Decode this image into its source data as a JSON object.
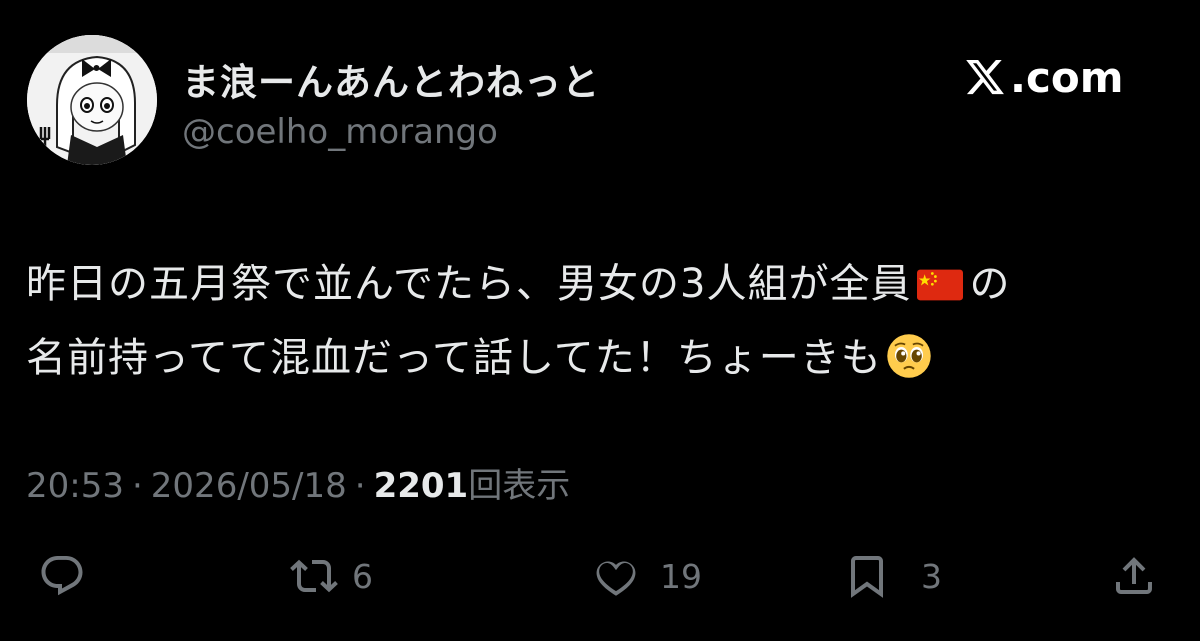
{
  "tweet": {
    "author": {
      "display_name": "ま浪ーんあんとわねっと",
      "handle": "@coelho_morango"
    },
    "brand": {
      "domain": ".com",
      "icon": "x-logo-icon"
    },
    "text": {
      "line1_before_flag": "昨日の五月祭で並んでたら、男女の3人組が全員",
      "line1_flag_emoji": "china-flag-emoji",
      "line1_after_flag": "の",
      "line2_before_emoji": "名前持ってて混血だって話してた！ちょーきも",
      "line2_emoji": "pleading-face-emoji"
    },
    "meta": {
      "time": "20:53",
      "separator": "·",
      "date": "2026/05/18",
      "views_count": "2201",
      "views_label": "回表示"
    },
    "actions": {
      "reply": {
        "icon": "reply-icon",
        "count": ""
      },
      "retweet": {
        "icon": "retweet-icon",
        "count": "6"
      },
      "like": {
        "icon": "heart-icon",
        "count": "19"
      },
      "bookmark": {
        "icon": "bookmark-icon",
        "count": "3"
      },
      "share": {
        "icon": "share-icon",
        "count": ""
      }
    }
  },
  "colors": {
    "background": "#000000",
    "primary_text": "#e7e9ea",
    "secondary_text": "#71767b",
    "flag_red": "#de2910",
    "flag_yellow": "#ffde00"
  }
}
